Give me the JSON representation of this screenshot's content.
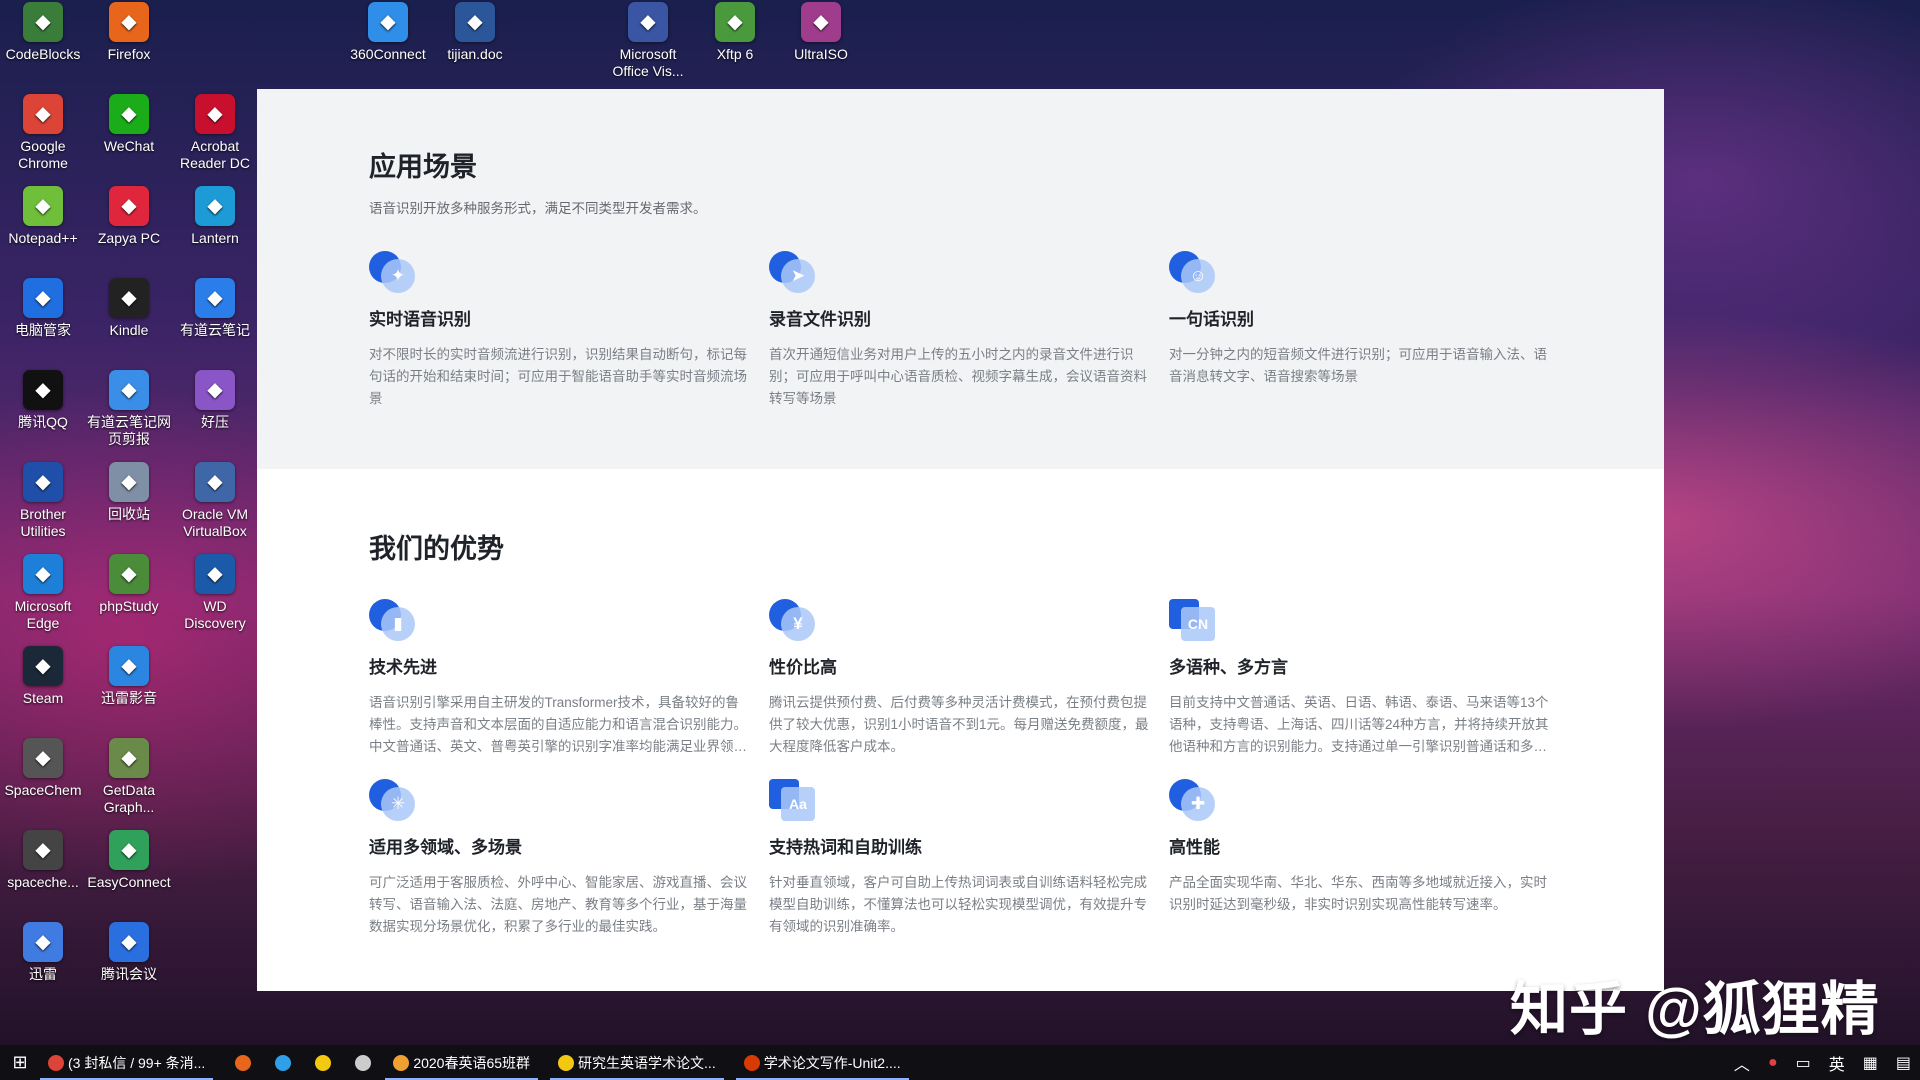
{
  "desktop_icons": [
    {
      "label": "CodeBlocks",
      "color": "#3a7d3a"
    },
    {
      "label": "Firefox",
      "color": "#e8661c"
    },
    {
      "label": "360Connect",
      "color": "#2f8ee8"
    },
    {
      "label": "tijian.doc",
      "color": "#2b579a"
    },
    {
      "label": "Microsoft Office Vis...",
      "color": "#3955a3"
    },
    {
      "label": "Xftp 6",
      "color": "#4a9a3d"
    },
    {
      "label": "UltraISO",
      "color": "#a03c8c"
    },
    {
      "label": "Google Chrome",
      "color": "#db4437"
    },
    {
      "label": "WeChat",
      "color": "#1aad19"
    },
    {
      "label": "Acrobat Reader DC",
      "color": "#c8102e"
    },
    {
      "label": "Notepad++",
      "color": "#6fbf3a"
    },
    {
      "label": "Zapya PC",
      "color": "#e0263d"
    },
    {
      "label": "Lantern",
      "color": "#1c9bd6"
    },
    {
      "label": "电脑管家",
      "color": "#1f6fe0"
    },
    {
      "label": "Kindle",
      "color": "#222222"
    },
    {
      "label": "有道云笔记",
      "color": "#2b7de9"
    },
    {
      "label": "腾讯QQ",
      "color": "#111111"
    },
    {
      "label": "有道云笔记网页剪报",
      "color": "#3a8ee8"
    },
    {
      "label": "好压",
      "color": "#8a56c7"
    },
    {
      "label": "Brother Utilities",
      "color": "#1f4fa8"
    },
    {
      "label": "回收站",
      "color": "#7f8fa6"
    },
    {
      "label": "Oracle VM VirtualBox",
      "color": "#3f67a8"
    },
    {
      "label": "Microsoft Edge",
      "color": "#1e7fd8"
    },
    {
      "label": "phpStudy",
      "color": "#4a8c3a"
    },
    {
      "label": "WD Discovery",
      "color": "#1a5aa8"
    },
    {
      "label": "Steam",
      "color": "#1b2838"
    },
    {
      "label": "迅雷影音",
      "color": "#2a86e0"
    },
    {
      "label": "SpaceChem",
      "color": "#555555"
    },
    {
      "label": "GetData Graph...",
      "color": "#6a8a4a"
    },
    {
      "label": "spaceche...",
      "color": "#444444"
    },
    {
      "label": "EasyConnect",
      "color": "#2fa15a"
    },
    {
      "label": "迅雷",
      "color": "#3f7be0"
    },
    {
      "label": "腾讯会议",
      "color": "#2a6fe0"
    }
  ],
  "scenarios": {
    "title": "应用场景",
    "subtitle": "语音识别开放多种服务形式，满足不同类型开发者需求。",
    "cards": [
      {
        "icon": "realtime-speech-icon",
        "glyph": "✦",
        "title": "实时语音识别",
        "desc": "对不限时长的实时音频流进行识别，识别结果自动断句，标记每句话的开始和结束时间；可应用于智能语音助手等实时音频流场景"
      },
      {
        "icon": "recording-file-icon",
        "glyph": "➤",
        "title": "录音文件识别",
        "desc": "首次开通短信业务对用户上传的五小时之内的录音文件进行识别；可应用于呼叫中心语音质检、视频字幕生成，会议语音资料转写等场景"
      },
      {
        "icon": "one-sentence-icon",
        "glyph": "☺",
        "title": "一句话识别",
        "desc": "对一分钟之内的短音频文件进行识别；可应用于语音输入法、语音消息转文字、语音搜索等场景"
      }
    ]
  },
  "advantages": {
    "title": "我们的优势",
    "cards": [
      {
        "icon": "advanced-tech-icon",
        "glyph": "▮",
        "title": "技术先进",
        "desc": "语音识别引擎采用自主研发的Transformer技术，具备较好的鲁棒性。支持声音和文本层面的自适应能力和语言混合识别能力。中文普通话、英文、普粤英引擎的识别字准率均能满足业界领先水平"
      },
      {
        "icon": "cost-effective-icon",
        "glyph": "¥",
        "title": "性价比高",
        "desc": "腾讯云提供预付费、后付费等多种灵活计费模式，在预付费包提供了较大优惠，识别1小时语音不到1元。每月赠送免费额度，最大程度降低客户成本。"
      },
      {
        "icon": "multilingual-icon",
        "glyph": "CN",
        "title": "多语种、多方言",
        "desc": "目前支持中文普通话、英语、日语、韩语、泰语、马来语等13个语种，支持粤语、上海话、四川话等24种方言，并将持续开放其他语种和方言的识别能力。支持通过单一引擎识别普通话和多种方言"
      },
      {
        "icon": "multi-domain-icon",
        "glyph": "✳",
        "title": "适用多领域、多场景",
        "desc": "可广泛适用于客服质检、外呼中心、智能家居、游戏直播、会议转写、语音输入法、法庭、房地产、教育等多个行业，基于海量数据实现分场景优化，积累了多行业的最佳实践。"
      },
      {
        "icon": "hotword-training-icon",
        "glyph": "Aa",
        "title": "支持热词和自助训练",
        "desc": "针对垂直领域，客户可自助上传热词词表或自训练语料轻松完成模型自助训练，不懂算法也可以轻松实现模型调优，有效提升专有领域的识别准确率。"
      },
      {
        "icon": "high-performance-icon",
        "glyph": "✚",
        "title": "高性能",
        "desc": "产品全面实现华南、华北、华东、西南等多地域就近接入，实时识别时延达到毫秒级，非实时识别实现高性能转写速率。"
      }
    ]
  },
  "taskbar": {
    "items": [
      {
        "label": "(3 封私信 / 99+ 条消...",
        "color": "#db4437",
        "active": true
      },
      {
        "label": "",
        "color": "#e8661c",
        "active": false
      },
      {
        "label": "",
        "color": "#2fa0e8",
        "active": false
      },
      {
        "label": "",
        "color": "#f2c811",
        "active": false
      },
      {
        "label": "",
        "color": "#cccccc",
        "active": false
      },
      {
        "label": "2020春英语65班群",
        "color": "#f0a030",
        "active": true
      },
      {
        "label": "研究生英语学术论文...",
        "color": "#f2c811",
        "active": true
      },
      {
        "label": "学术论文写作-Unit2....",
        "color": "#d83b01",
        "active": true
      }
    ],
    "tray": {
      "ime": "英"
    }
  },
  "watermark": "知乎 @狐狸精"
}
